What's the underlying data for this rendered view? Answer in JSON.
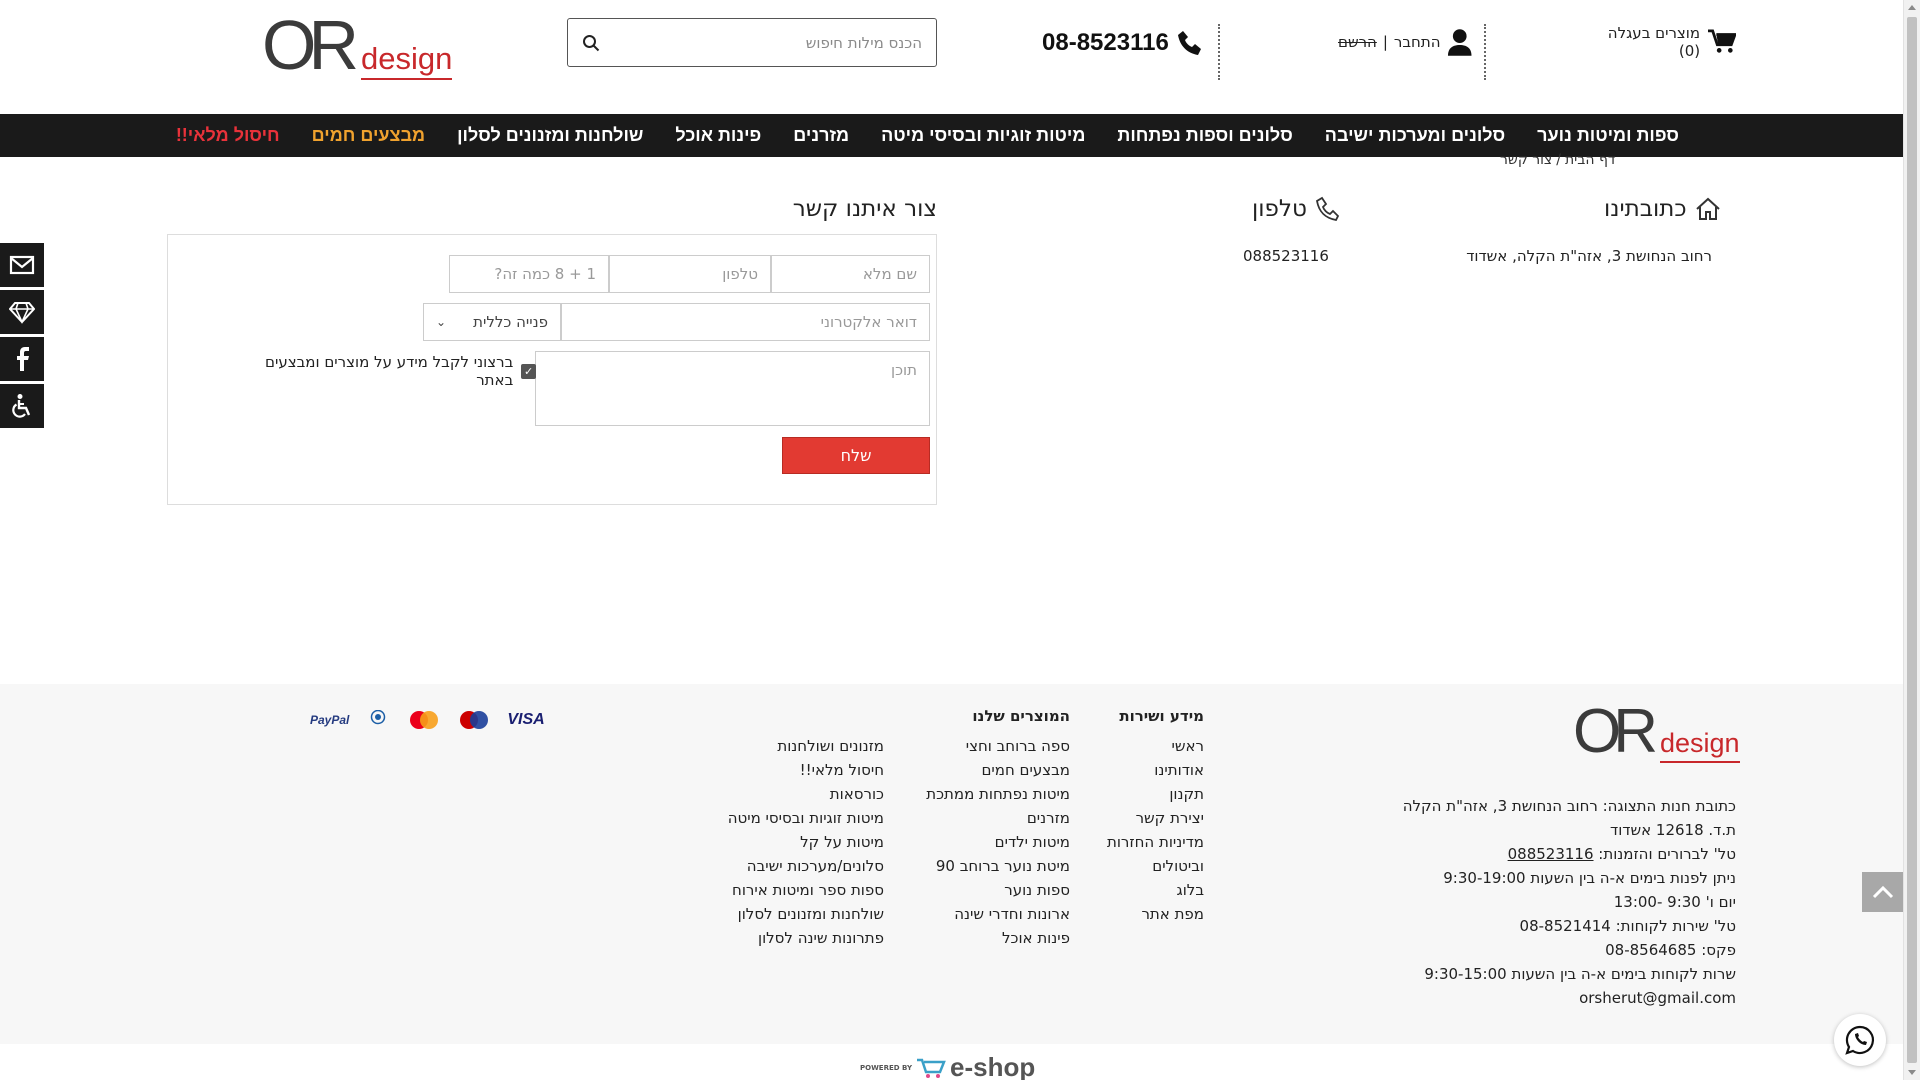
{
  "header": {
    "cart_label": "מוצרים בעגלה (0)",
    "login_label": "התחבר",
    "divider": "|",
    "register_label": "הרשם",
    "phone": "08-8523116",
    "search_placeholder": "הכנס מילות חיפוש",
    "logo_or": "OR",
    "logo_design": "design"
  },
  "nav": {
    "items": [
      {
        "label": "ספות ומיטות נוער",
        "color": "#ffffff"
      },
      {
        "label": "סלונים ומערכות ישיבה",
        "color": "#ffffff"
      },
      {
        "label": "סלונים וספות נפתחות",
        "color": "#ffffff"
      },
      {
        "label": "מיטות זוגיות ובסיסי מיטה",
        "color": "#ffffff"
      },
      {
        "label": "מזרנים",
        "color": "#ffffff"
      },
      {
        "label": "פינות אוכל",
        "color": "#ffffff"
      },
      {
        "label": "שולחנות ומזנונים לסלון",
        "color": "#ffffff"
      },
      {
        "label": "מבצעים חמים",
        "color": "#f0a22e"
      },
      {
        "label": "חיסול מלאי!!",
        "color": "#e8323a"
      }
    ]
  },
  "breadcrumb": {
    "home": "דף הבית",
    "separator": "/",
    "current": "צור קשר"
  },
  "side_icons": [
    "envelope-icon",
    "diamond-icon",
    "facebook-icon",
    "accessibility-icon"
  ],
  "contact": {
    "address_title": "כתובתינו",
    "address_text": "רחוב הנחושת 3, אזה\"ת הקלה, אשדוד",
    "phone_title": "טלפון",
    "phone_text": "088523116"
  },
  "form": {
    "title": "צור איתנו קשר",
    "name_placeholder": "שם מלא",
    "phone_placeholder": "טלפון",
    "captcha_placeholder": "1 + 8 כמה זה?",
    "email_placeholder": "דואר אלקטרוני",
    "select_value": "פנייה כללית",
    "content_placeholder": "תוכן",
    "checkbox_label": "ברצוני לקבל מידע על מוצרים ומבצעים באתר",
    "checkbox_checked": true,
    "submit_label": "שלח"
  },
  "footer": {
    "contact_lines": [
      "כתובת חנות התצוגה: רחוב הנחושת 3, אזה\"ת הקלה",
      "ת.ד. 12618 אשדוד"
    ],
    "phone_prefix": "טל' לברורים והזמנות: ",
    "phone_link": "088523116",
    "contact_lines_2": [
      "ניתן לפנות בימים א-ה בין השעות 9:30-19:00",
      "יום ו' 9:30 -13:00",
      "טל' שירות לקוחות: 08-8521414",
      "פקס: 08-8564685",
      "שרות לקוחות בימים א-ה בין השעות 9:30-15:00",
      "orsherut@gmail.com"
    ],
    "info_title": "מידע ושירות",
    "info_links": [
      "ראשי",
      "אודותינו",
      "תקנון",
      "יצירת קשר",
      "מדיניות החזרות",
      "וביטולים",
      "בלוג",
      "מפת אתר"
    ],
    "products_title": "המוצרים שלנו",
    "products_links": [
      "ספה ברוחב וחצי",
      "מבצעים חמים",
      "מיטות נפתחות ממתכת",
      "מזרנים",
      "מיטות ילדים",
      "מיטת נוער ברוחב 90",
      "ספות נוער",
      "ארונות וחדרי שינה",
      "פינות אוכל"
    ],
    "more_links": [
      "מזנונים ושולחנות",
      "חיסול מלאי!!",
      "כורסאות",
      "מיטות זוגיות ובסיסי מיטה",
      "מיטות על קל",
      "סלונים/מערכות ישיבה",
      "ספות ספר ומיטות אירוח",
      "שולחנות ומזנונים לסלון",
      "פתרונות שינה לסלון"
    ],
    "payments": {
      "paypal": "PayPal",
      "diners": "Diners Club",
      "visa": "VISA"
    }
  },
  "powered": {
    "prefix": "POWERED BY",
    "brand": "e-shop"
  },
  "colors": {
    "accent_red": "#e23a32",
    "nav_bg": "#1a1a1a",
    "logo_red": "#c8282b"
  }
}
